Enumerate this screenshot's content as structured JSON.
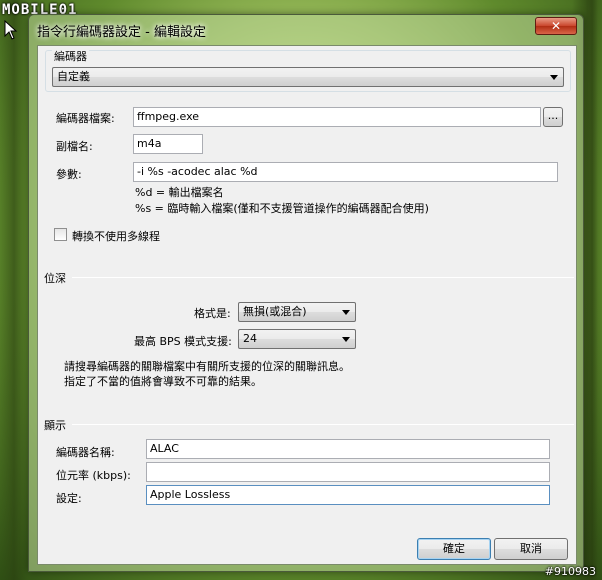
{
  "watermark": {
    "logo_text": "MOBILE01",
    "image_id": "#910983"
  },
  "window": {
    "title": "指令行編碼器設定 - 編輯設定",
    "close_glyph": "✕"
  },
  "encoder_group": {
    "caption": "編碼器",
    "preset": "自定義"
  },
  "fields": {
    "encoder_file_label": "編碼器檔案:",
    "encoder_file_value": "ffmpeg.exe",
    "browse_label": "...",
    "extension_label": "副檔名:",
    "extension_value": "m4a",
    "params_label": "參數:",
    "params_value": "-i %s -acodec alac %d",
    "hint_d": "%d = 輸出檔案名",
    "hint_s": "%s = 臨時輸入檔案(僅和不支援管道操作的編碼器配合使用)",
    "no_multithread_label": "轉換不使用多線程",
    "no_multithread_checked": false
  },
  "bitdepth": {
    "caption": "位深",
    "format_label": "格式是:",
    "format_value": "無損(或混合)",
    "max_bps_label": "最高 BPS 模式支援:",
    "max_bps_value": "24",
    "note_line1": "請搜尋編碼器的關聯檔案中有關所支援的位深的關聯訊息。",
    "note_line2": "指定了不當的值將會導致不可靠的結果。"
  },
  "display": {
    "caption": "顯示",
    "encoder_name_label": "編碼器名稱:",
    "encoder_name_value": "ALAC",
    "bitrate_label": "位元率 (kbps):",
    "bitrate_value": "",
    "setting_label": "設定:",
    "setting_value": "Apple Lossless"
  },
  "buttons": {
    "ok": "確定",
    "cancel": "取消"
  }
}
